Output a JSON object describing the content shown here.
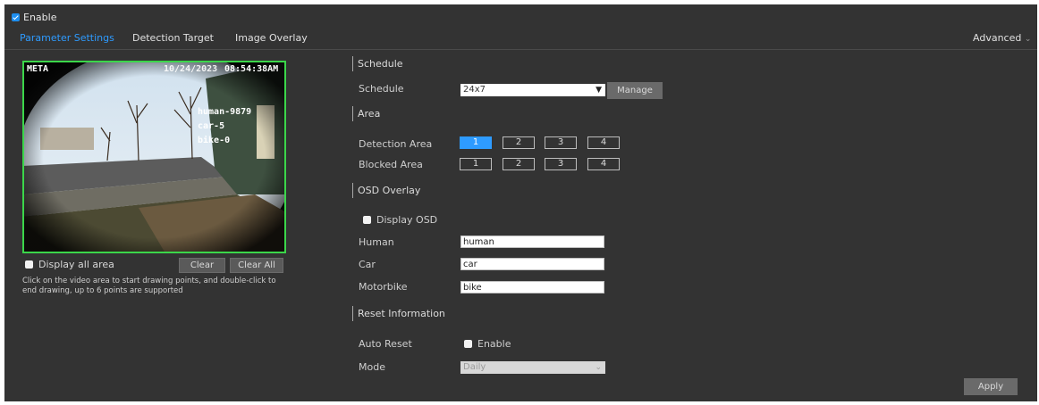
{
  "enable": {
    "label": "Enable",
    "checked": true
  },
  "tabs": [
    {
      "label": "Parameter Settings",
      "active": true
    },
    {
      "label": "Detection Target",
      "active": false
    },
    {
      "label": "Image Overlay",
      "active": false
    }
  ],
  "advanced": {
    "label": "Advanced"
  },
  "video": {
    "osd_left": "META",
    "osd_time": "08:54:38AM",
    "osd_date": "10/24/2023",
    "counts": [
      "human-9879",
      "car-5",
      "bike-0"
    ]
  },
  "left_panel": {
    "display_all_area": {
      "label": "Display all area",
      "checked": false
    },
    "clear_label": "Clear",
    "clear_all_label": "Clear All",
    "hint": "Click on the video area to start drawing points, and double-click to end drawing, up to 6 points are supported"
  },
  "schedule": {
    "section": "Schedule",
    "label": "Schedule",
    "value": "24x7",
    "manage_label": "Manage"
  },
  "area": {
    "section": "Area",
    "detection_label": "Detection Area",
    "blocked_label": "Blocked Area",
    "detection_buttons": [
      "1",
      "2",
      "3",
      "4"
    ],
    "blocked_buttons": [
      "1",
      "2",
      "3",
      "4"
    ]
  },
  "osd": {
    "section": "OSD Overlay",
    "display_osd": {
      "label": "Display OSD",
      "checked": false
    },
    "human_label": "Human",
    "human_value": "human",
    "car_label": "Car",
    "car_value": "car",
    "motorbike_label": "Motorbike",
    "motorbike_value": "bike"
  },
  "reset": {
    "section": "Reset Information",
    "auto_reset_label": "Auto Reset",
    "enable": {
      "label": "Enable",
      "checked": false
    },
    "mode_label": "Mode",
    "mode_value": "Daily"
  },
  "apply_label": "Apply",
  "colors": {
    "accent": "#2e9bff",
    "panel": "#333333",
    "roi_border": "#3bd64a"
  }
}
